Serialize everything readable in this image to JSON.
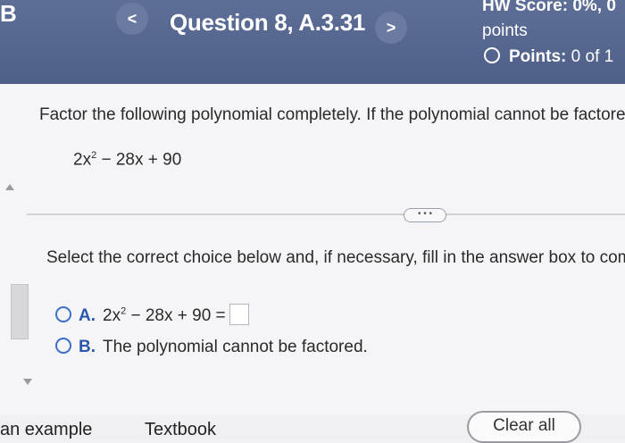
{
  "header": {
    "left_letter": "B",
    "prev_label": "<",
    "next_label": ">",
    "question_title": "Question 8, A.3.31",
    "score_label": "HW Score: 0%, 0",
    "score_sub": "points",
    "points_label": "Points:",
    "points_value": "0 of 1"
  },
  "question": {
    "instruction": "Factor the following polynomial completely. If the polynomial cannot be factored",
    "poly_prefix": "2x",
    "poly_exp": "2",
    "poly_suffix": " − 28x + 90",
    "more_label": "• • •"
  },
  "answer": {
    "instruction": "Select the correct choice below and, if necessary, fill in the answer box to comple",
    "choice_a_letter": "A.",
    "choice_a_prefix": "2x",
    "choice_a_exp": "2",
    "choice_a_suffix": " − 28x + 90 =",
    "choice_b_letter": "B.",
    "choice_b_text": "The polynomial cannot be factored."
  },
  "footer": {
    "example_label": "an example",
    "textbook_label": "Textbook",
    "clear_label": "Clear all"
  },
  "colors": {
    "header_bg": "#51628b",
    "radio": "#3b6fc5",
    "choice_letter": "#2b58ac"
  }
}
